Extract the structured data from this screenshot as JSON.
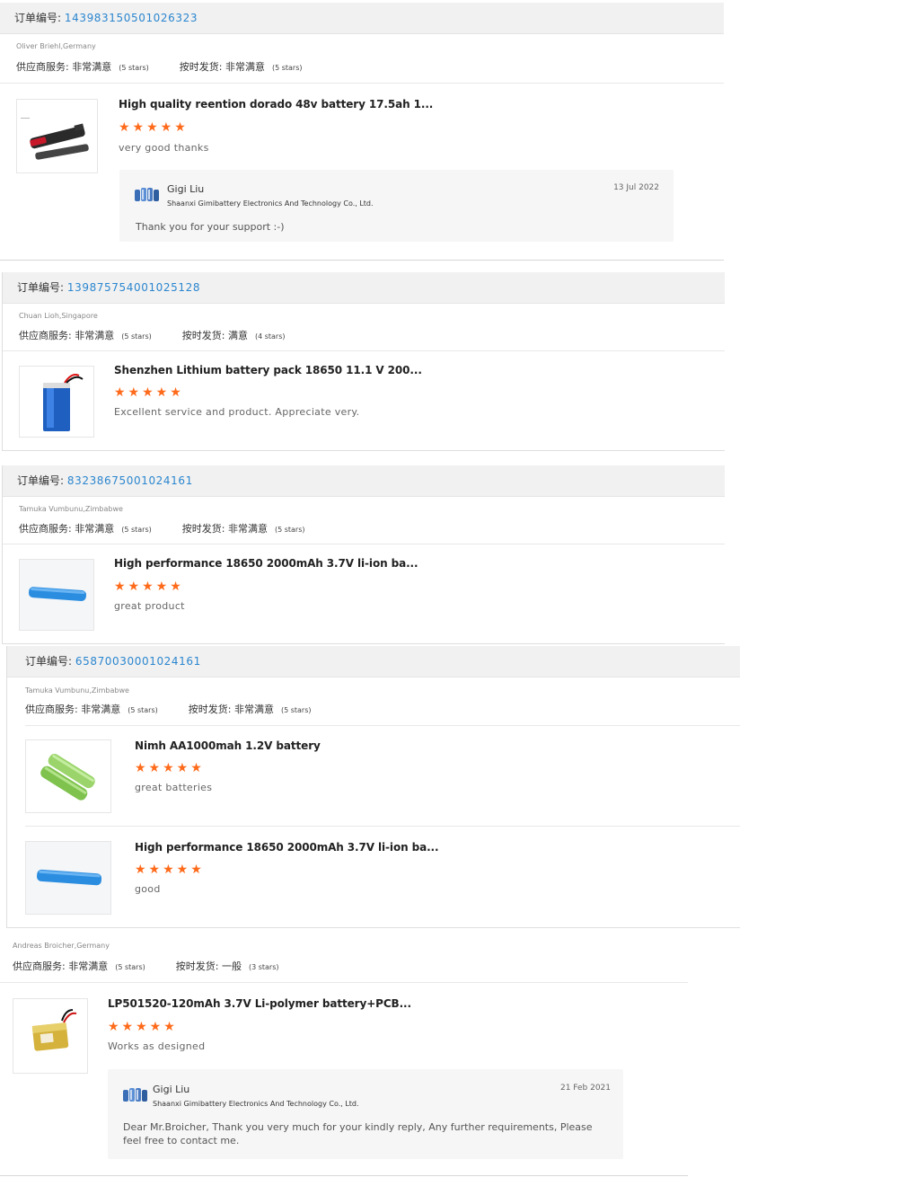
{
  "labels": {
    "order_no": "订单编号: ",
    "supplier_service": "供应商服务: ",
    "on_time_shipping": "按时发货: "
  },
  "orders": [
    {
      "order_number": "143983150501026323",
      "buyer": "Oliver Briehl,Germany",
      "supplier_rating": "非常满意",
      "supplier_stars": "(5 stars)",
      "shipping_rating": "非常满意",
      "shipping_stars": "(5 stars)",
      "items": [
        {
          "product": "High quality reention dorado 48v battery 17.5ah 1...",
          "stars": "★★★★★",
          "review": "very good thanks",
          "image": "ebike-battery-image",
          "reply": {
            "seller_name": "Gigi Liu",
            "company": "Shaanxi Gimibattery Electronics And Technology Co., Ltd.",
            "date": "13 Jul 2022",
            "text": "Thank you for your support :-)"
          }
        }
      ]
    },
    {
      "order_number": "139875754001025128",
      "buyer": "Chuan Lioh,Singapore",
      "supplier_rating": "非常满意",
      "supplier_stars": "(5 stars)",
      "shipping_rating": "满意",
      "shipping_stars": "(4 stars)",
      "items": [
        {
          "product": "Shenzhen Lithium battery pack 18650 11.1 V 200...",
          "stars": "★★★★★",
          "review": "Excellent service and product. Appreciate very.",
          "image": "blue-battery-pack-image"
        }
      ]
    },
    {
      "order_number": "83238675001024161",
      "buyer": "Tamuka Vumbunu,Zimbabwe",
      "supplier_rating": "非常满意",
      "supplier_stars": "(5 stars)",
      "shipping_rating": "非常满意",
      "shipping_stars": "(5 stars)",
      "items": [
        {
          "product": "High performance 18650 2000mAh 3.7V li-ion ba...",
          "stars": "★★★★★",
          "review": "great product",
          "image": "blue-cell-image"
        }
      ]
    },
    {
      "order_number": "65870030001024161",
      "buyer": "Tamuka Vumbunu,Zimbabwe",
      "supplier_rating": "非常满意",
      "supplier_stars": "(5 stars)",
      "shipping_rating": "非常满意",
      "shipping_stars": "(5 stars)",
      "items": [
        {
          "product": "Nimh AA1000mah 1.2V battery",
          "stars": "★★★★★",
          "review": "great batteries",
          "image": "green-nimh-cells-image"
        },
        {
          "product": "High performance 18650 2000mAh 3.7V li-ion ba...",
          "stars": "★★★★★",
          "review": "good",
          "image": "blue-cell-image"
        }
      ]
    },
    {
      "buyer": "Andreas Broicher,Germany",
      "supplier_rating": "非常满意",
      "supplier_stars": "(5 stars)",
      "shipping_rating": "一般",
      "shipping_stars": "(3 stars)",
      "items": [
        {
          "product": "LP501520-120mAh 3.7V Li-polymer battery+PCB...",
          "stars": "★★★★★",
          "review": "Works as designed",
          "image": "lipo-battery-image",
          "reply": {
            "seller_name": "Gigi Liu",
            "company": "Shaanxi Gimibattery Electronics And Technology Co., Ltd.",
            "date": "21 Feb 2021",
            "text": "Dear Mr.Broicher, Thank you very much for your kindly reply, Any further requirements, Please feel free to contact me."
          }
        }
      ]
    }
  ],
  "colors": {
    "order_number": "#2b86cf",
    "star": "#ff6a1a",
    "header_bg": "#f1f1f1"
  }
}
